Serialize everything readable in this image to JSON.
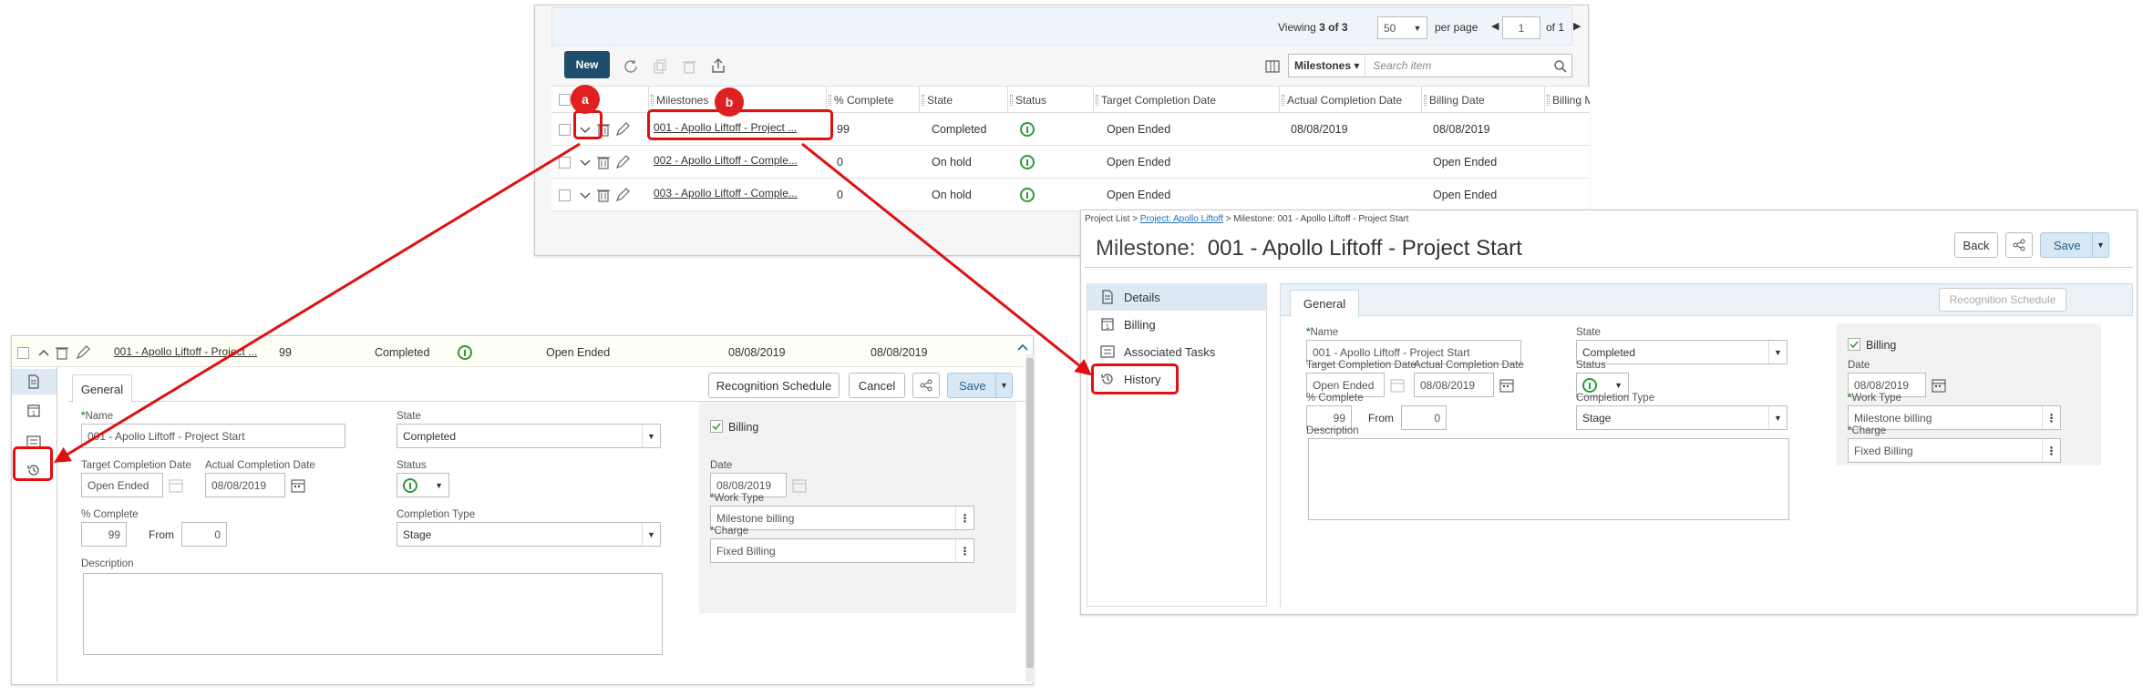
{
  "grid": {
    "pager": {
      "viewing_label": "Viewing",
      "viewing_value": "3 of 3",
      "per_page_value": "50",
      "per_page_label": "per page",
      "page_value": "1",
      "of_label": "of 1"
    },
    "toolbar": {
      "new_label": "New",
      "search_scope": "Milestones",
      "search_placeholder": "Search item"
    },
    "headers": [
      "Milestones",
      "% Complete",
      "State",
      "Status",
      "Target Completion Date",
      "Actual Completion Date",
      "Billing Date",
      "Billing Mile"
    ],
    "rows": [
      {
        "milestone": "001 - Apollo Liftoff - Project ...",
        "pct": "99",
        "state": "Completed",
        "target": "Open Ended",
        "actual": "08/08/2019",
        "billing": "08/08/2019"
      },
      {
        "milestone": "002 - Apollo Liftoff - Comple...",
        "pct": "0",
        "state": "On hold",
        "target": "Open Ended",
        "actual": "",
        "billing": "Open Ended"
      },
      {
        "milestone": "003 - Apollo Liftoff - Comple...",
        "pct": "0",
        "state": "On hold",
        "target": "Open Ended",
        "actual": "",
        "billing": "Open Ended"
      }
    ]
  },
  "badges": {
    "a": "a",
    "b": "b"
  },
  "inline": {
    "row": {
      "milestone": "001 - Apollo Liftoff - Project ...",
      "pct": "99",
      "state": "Completed",
      "target": "Open Ended",
      "actual": "08/08/2019",
      "billing": "08/08/2019"
    },
    "tab_general": "General",
    "recognition_label": "Recognition Schedule",
    "cancel_label": "Cancel",
    "save_label": "Save",
    "form": {
      "name_label": "Name",
      "name_value": "001 - Apollo Liftoff - Project Start",
      "state_label": "State",
      "state_value": "Completed",
      "target_label": "Target Completion Date",
      "target_value": "Open Ended",
      "actual_label": "Actual Completion Date",
      "actual_value": "08/08/2019",
      "status_label": "Status",
      "pct_label": "% Complete",
      "pct_value": "99",
      "from_label": "From",
      "from_value": "0",
      "ctype_label": "Completion Type",
      "ctype_value": "Stage",
      "desc_label": "Description",
      "billing_label": "Billing",
      "date_label": "Date",
      "date_value": "08/08/2019",
      "worktype_label": "Work Type",
      "worktype_value": "Milestone billing",
      "charge_label": "Charge",
      "charge_value": "Fixed Billing"
    }
  },
  "detail": {
    "breadcrumb": {
      "part1": "Project List >",
      "part2": "Project: Apollo Liftoff",
      "part3": "> Milestone: 001 - Apollo Liftoff - Project Start"
    },
    "title_prefix": "Milestone:",
    "title_name": "001 - Apollo Liftoff - Project Start",
    "back_label": "Back",
    "save_label": "Save",
    "nav": [
      "Details",
      "Billing",
      "Associated Tasks",
      "History"
    ],
    "tab_general": "General",
    "recognition_label": "Recognition Schedule",
    "form": {
      "name_label": "Name",
      "name_value": "001 - Apollo Liftoff - Project Start",
      "state_label": "State",
      "state_value": "Completed",
      "target_label": "Target Completion Date",
      "target_value": "Open Ended",
      "actual_label": "Actual Completion Date",
      "actual_value": "08/08/2019",
      "status_label": "Status",
      "pct_label": "% Complete",
      "pct_value": "99",
      "from_label": "From",
      "from_value": "0",
      "ctype_label": "Completion Type",
      "ctype_value": "Stage",
      "desc_label": "Description",
      "billing_label": "Billing",
      "date_label": "Date",
      "date_value": "08/08/2019",
      "worktype_label": "Work Type",
      "worktype_value": "Milestone billing",
      "charge_label": "Charge",
      "charge_value": "Fixed Billing"
    }
  },
  "colors": {
    "accent_red": "#e01010",
    "primary": "#1e4e6c",
    "status_green": "#2c9a3a",
    "link_blue": "#1f6fb5"
  },
  "icons": [
    "chevron-down-icon",
    "chevron-up-icon",
    "trash-icon",
    "pencil-icon",
    "refresh-icon",
    "copy-icon",
    "export-icon",
    "columns-icon",
    "search-icon",
    "calendar-icon",
    "share-icon",
    "kebab-icon",
    "history-icon",
    "document-icon",
    "billing-icon",
    "tasks-icon",
    "checkmark-icon",
    "status-icon"
  ]
}
